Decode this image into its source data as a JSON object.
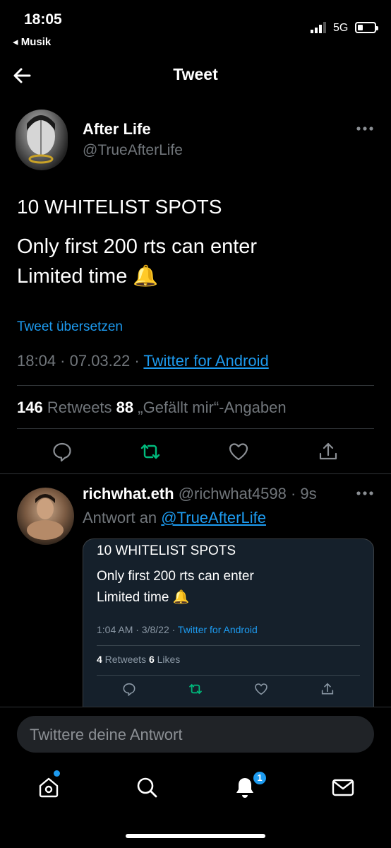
{
  "status_bar": {
    "time": "18:05",
    "back_app": "◂ Musik",
    "network": "5G"
  },
  "header": {
    "title": "Tweet"
  },
  "main_tweet": {
    "author_name": "After Life",
    "author_handle": "@TrueAfterLife",
    "text_line1": "10 WHITELIST SPOTS",
    "text_line2": "Only first 200 rts can enter",
    "text_line3": "Limited time 🔔",
    "translate_label": "Tweet übersetzen",
    "time": "18:04 · 07.03.22 · ",
    "source": "Twitter for Android",
    "retweet_count": "146",
    "retweet_label": " Retweets  ",
    "like_count": "88",
    "like_label": " „Gefällt mir“-Angaben"
  },
  "reply": {
    "author_name": "richwhat.eth",
    "author_handle_time": " @richwhat4598 · 9s",
    "reply_to_prefix": "Antwort an ",
    "reply_to_handle": "@TrueAfterLife",
    "quote": {
      "line1": "10 WHITELIST SPOTS",
      "line2": "Only first 200 rts can enter",
      "line3": "Limited time 🔔",
      "time": "1:04 AM · 3/8/22 · ",
      "source": "Twitter for Android",
      "retweet_count": "4",
      "retweet_label": " Retweets  ",
      "like_count": "6",
      "like_label": " Likes"
    }
  },
  "composer": {
    "placeholder": "Twittere deine Antwort"
  },
  "tab_bar": {
    "notification_badge": "1"
  },
  "colors": {
    "accent": "#1d9bf0",
    "retweet_green": "#00ba7c",
    "muted": "#71767b",
    "background": "#000000"
  }
}
